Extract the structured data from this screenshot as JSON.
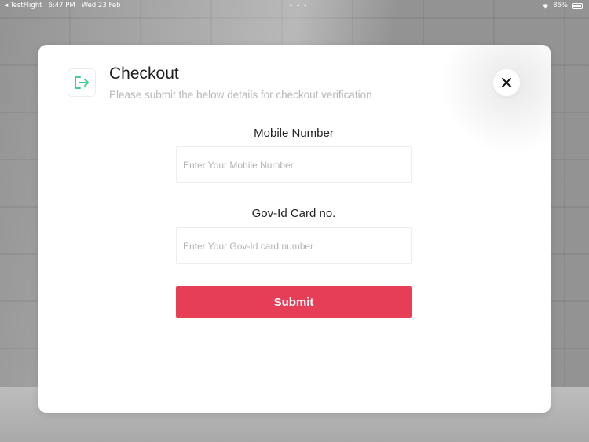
{
  "status_bar": {
    "app": "TestFlight",
    "time": "6:47 PM",
    "date": "Wed 23 Feb",
    "dots": "• • •",
    "battery": "86%"
  },
  "modal": {
    "icon": "exit-arrow-icon",
    "title": "Checkout",
    "subtitle": "Please submit the below details for checkout verification",
    "close_icon": "close-icon",
    "fields": [
      {
        "label": "Mobile Number",
        "placeholder": "Enter Your Mobile Number",
        "value": ""
      },
      {
        "label": "Gov-Id Card no.",
        "placeholder": "Enter Your Gov-Id card number",
        "value": ""
      }
    ],
    "submit_label": "Submit"
  },
  "colors": {
    "accent": "#e63e57",
    "icon_green": "#3ecf8e"
  }
}
